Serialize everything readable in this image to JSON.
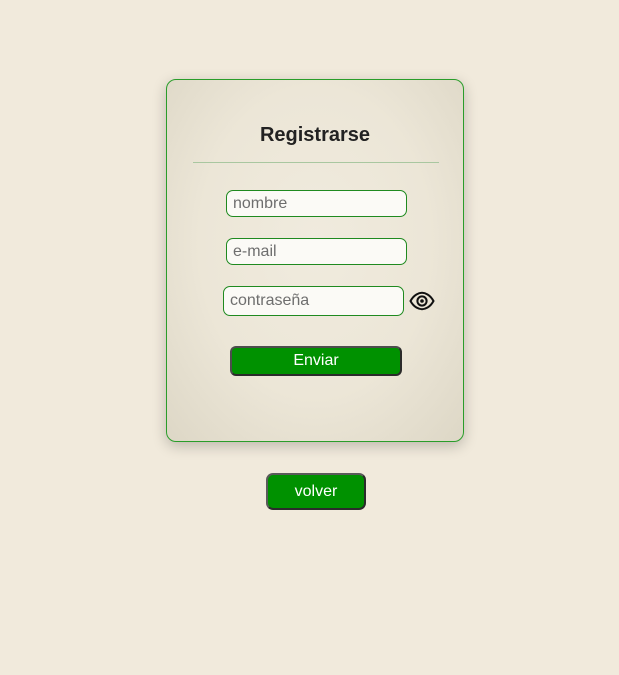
{
  "form": {
    "title": "Registrarse",
    "name_placeholder": "nombre",
    "email_placeholder": "e-mail",
    "password_placeholder": "contraseña",
    "show_password_icon": "eye-icon",
    "submit_label": "Enviar"
  },
  "back_label": "volver",
  "colors": {
    "background": "#f1eadc",
    "accent_green": "#009100",
    "border_green": "#2a9d2a"
  }
}
